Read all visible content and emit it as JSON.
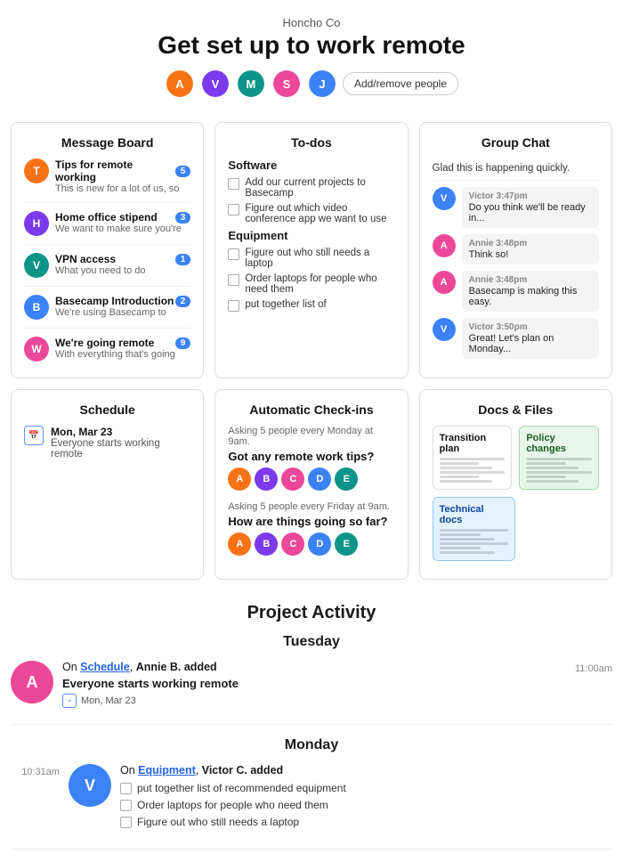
{
  "header": {
    "company": "Honcho Co",
    "title": "Get set up to work remote",
    "add_people_label": "Add/remove people"
  },
  "message_board": {
    "title": "Message Board",
    "items": [
      {
        "title": "Tips for remote working",
        "desc": "This is new for a lot of us, so",
        "badge": "5",
        "color": "#f97316"
      },
      {
        "title": "Home office stipend",
        "desc": "We want to make sure you're",
        "badge": "3",
        "color": "#7c3aed"
      },
      {
        "title": "VPN access",
        "desc": "What you need to do",
        "badge": "1",
        "color": "#0d9488"
      },
      {
        "title": "Basecamp Introduction",
        "desc": "We're using Basecamp to",
        "badge": "2",
        "color": "#3b82f6"
      },
      {
        "title": "We're going remote",
        "desc": "With everything that's going",
        "badge": "9",
        "color": "#ec4899"
      }
    ]
  },
  "todos": {
    "title": "To-dos",
    "sections": [
      {
        "name": "Software",
        "items": [
          "Add our current projects to Basecamp",
          "Figure out which video conference app we want to use"
        ]
      },
      {
        "name": "Equipment",
        "items": [
          "Figure out who still needs a laptop",
          "Order laptops for people who need them",
          "put together list of"
        ]
      }
    ]
  },
  "group_chat": {
    "title": "Group Chat",
    "first_message": "Glad this is happening quickly.",
    "messages": [
      {
        "name": "Victor",
        "time": "3:47pm",
        "text": "Do you think we'll be ready in...",
        "color": "#3b82f6"
      },
      {
        "name": "Annie",
        "time": "3:48pm",
        "text": "Think so!",
        "color": "#ec4899"
      },
      {
        "name": "Annie",
        "time": "3:48pm",
        "text": "Basecamp is making this easy.",
        "color": "#ec4899"
      },
      {
        "name": "Victor",
        "time": "3:50pm",
        "text": "Great! Let's plan on Monday...",
        "color": "#3b82f6"
      }
    ]
  },
  "schedule": {
    "title": "Schedule",
    "events": [
      {
        "date": "Mon, Mar 23",
        "desc": "Everyone starts working remote"
      }
    ]
  },
  "auto_checkins": {
    "title": "Automatic Check-ins",
    "blocks": [
      {
        "freq": "Asking 5 people every Monday at 9am.",
        "question": "Got any remote work tips?"
      },
      {
        "freq": "Asking 5 people every Friday at 9am.",
        "question": "How are things going so far?"
      }
    ]
  },
  "docs": {
    "title": "Docs & Files",
    "cards": [
      {
        "title": "Transition plan",
        "style": "default"
      },
      {
        "title": "Policy changes",
        "style": "green"
      },
      {
        "title": "Technical docs",
        "style": "blue"
      }
    ]
  },
  "project_activity": {
    "title": "Project Activity",
    "days": [
      {
        "label": "Tuesday",
        "entries": [
          {
            "side": "left",
            "time": "11:00am",
            "link_section": "Schedule",
            "person": "Annie B.",
            "action": "added",
            "items": [
              "Everyone starts working remote"
            ],
            "date": "Mon, Mar 23",
            "avatar_color": "#ec4899"
          }
        ]
      },
      {
        "label": "Monday",
        "entries": [
          {
            "side": "right",
            "time": "10:31am",
            "link_section": "Equipment",
            "person": "Victor C.",
            "action": "added",
            "items": [
              "put together list of recommended equipment",
              "Order laptops for people who need them",
              "Figure out who still needs a laptop"
            ],
            "avatar_color": "#3b82f6"
          }
        ]
      }
    ]
  }
}
